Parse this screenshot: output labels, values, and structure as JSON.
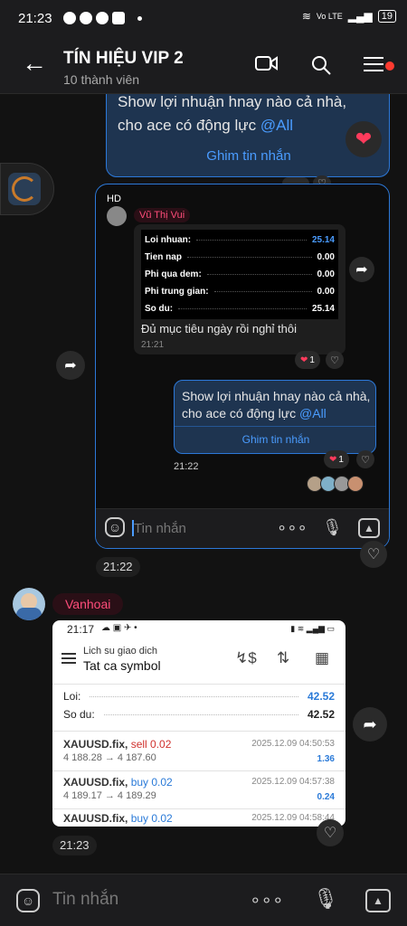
{
  "status_bar": {
    "time": "21:23",
    "network": "Vo LTE",
    "battery": "19"
  },
  "header": {
    "title": "TÍN HIỆU VIP 2",
    "subtitle": "10 thành viên"
  },
  "top_bubble": {
    "text_line1": "Show lợi nhuận hnay nào cả nhà,",
    "text_line2": "cho ace có động lực ",
    "mention": "@All",
    "pin_label": "Ghim tin nhắn"
  },
  "forwarded": {
    "sender_initials": "HD",
    "sender_name": "Vũ Thị Vui",
    "stats": [
      {
        "label": "Loi nhuan:",
        "value": "25.14"
      },
      {
        "label": "Tien nap",
        "value": "0.00"
      },
      {
        "label": "Phi qua dem:",
        "value": "0.00"
      },
      {
        "label": "Phi trung gian:",
        "value": "0.00"
      },
      {
        "label": "So du:",
        "value": "25.14"
      }
    ],
    "caption": "Đủ mục tiêu ngày rồi nghỉ thôi",
    "caption_time": "21:21",
    "reaction_count": "1",
    "bubble": {
      "text_line1": "Show lợi nhuận hnay nào cả nhà,",
      "text_line2": "cho ace có động lực ",
      "mention": "@All",
      "pin_label": "Ghim tin nhắn",
      "reaction_count": "1"
    },
    "bubble_time": "21:22",
    "input_placeholder": "Tin nhắn"
  },
  "message1_time": "21:22",
  "message2": {
    "sender_name": "Vanhoai",
    "shot": {
      "time": "21:17",
      "header_small": "Lich su giao dich",
      "header_big": "Tat ca symbol",
      "summary": [
        {
          "label": "Loi:",
          "value": "42.52"
        },
        {
          "label": "So du:",
          "value": "42.52"
        }
      ],
      "deals": [
        {
          "symbol": "XAUUSD.fix,",
          "side": "sell 0.02",
          "prices": "4 188.28 → 4 187.60",
          "date": "2025.12.09 04:50:53",
          "profit": "1.36"
        },
        {
          "symbol": "XAUUSD.fix,",
          "side": "buy 0.02",
          "prices": "4 189.17 → 4 189.29",
          "date": "2025.12.09 04:57:38",
          "profit": "0.24"
        },
        {
          "symbol": "XAUUSD.fix,",
          "side": "buy 0.02",
          "prices": "",
          "date": "2025.12.09 04:58:44",
          "profit": ""
        }
      ]
    },
    "time": "21:23"
  },
  "composer": {
    "placeholder": "Tin nhắn"
  },
  "colors": {
    "accent": "#2c78d8",
    "mention": "#4a9cff",
    "name_pink": "#ff4d7a",
    "heart": "#ff3b5c"
  },
  "icons": [
    "back-arrow-icon",
    "video-call-icon",
    "search-icon",
    "menu-list-icon",
    "forward-icon",
    "heart-icon",
    "emoji-icon",
    "more-icon",
    "mic-icon",
    "gallery-icon"
  ]
}
